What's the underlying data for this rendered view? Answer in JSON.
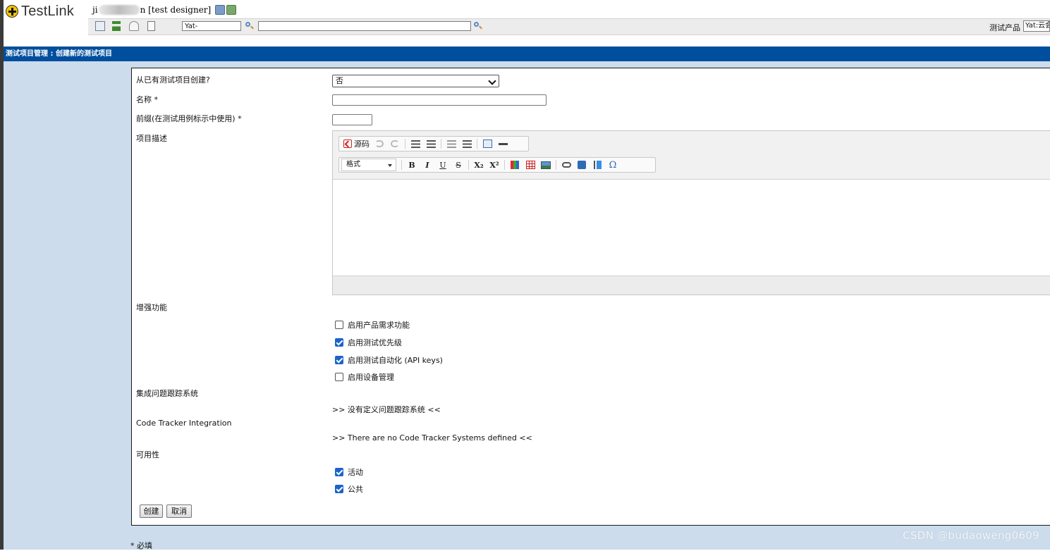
{
  "header": {
    "logo_text": "TestLink",
    "user_prefix": "ji",
    "user_suffix": "n [test designer]",
    "toolbar_field1": "Yat-",
    "toolbar_field2": "",
    "product_label": "测试产品",
    "product_value": "Yat:云会"
  },
  "page": {
    "title": "测试项目管理 : 创建新的测试项目"
  },
  "form": {
    "from_existing_label": "从已有测试项目创建?",
    "from_existing_value": "否",
    "name_label": "名称 *",
    "name_value": "",
    "prefix_label": "前缀(在测试用例标示中使用) *",
    "prefix_value": "",
    "description_label": "项目描述",
    "editor": {
      "source_label": "源码",
      "format_label": "格式",
      "bold": "B",
      "italic": "I",
      "underline": "U",
      "strike": "S",
      "subscript": "X₂",
      "superscript": "X²",
      "special_char": "Ω"
    },
    "enhanced_label": "增强功能",
    "options": [
      {
        "label": "启用产品需求功能",
        "checked": false
      },
      {
        "label": "启用测试优先级",
        "checked": true
      },
      {
        "label": "启用测试自动化 (API keys)",
        "checked": true
      },
      {
        "label": "启用设备管理",
        "checked": false
      }
    ],
    "issue_tracker_label": "集成问题跟踪系统",
    "issue_tracker_note": ">> 没有定义问题跟踪系统 <<",
    "code_tracker_label": "Code Tracker Integration",
    "code_tracker_note": ">> There are no Code Tracker Systems defined <<",
    "availability_label": "可用性",
    "availability": [
      {
        "label": "活动",
        "checked": true
      },
      {
        "label": "公共",
        "checked": true
      }
    ],
    "create_button": "创建",
    "cancel_button": "取消",
    "required_note": "* 必填"
  },
  "watermark": "CSDN @budaoweng0609",
  "colors": {
    "title_bar": "#004f9e",
    "work_area": "#ccdcec",
    "checkbox_checked": "#1b63cc"
  }
}
